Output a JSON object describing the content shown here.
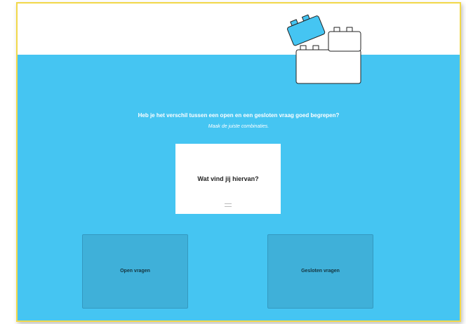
{
  "exercise": {
    "question": "Heb je het verschil tussen een open en een gesloten vraag goed begrepen?",
    "instruction": "Maak de juiste combinaties."
  },
  "card": {
    "text": "Wat vind jij hiervan?"
  },
  "targets": [
    {
      "label": "Open vragen"
    },
    {
      "label": "Gesloten vragen"
    }
  ],
  "colors": {
    "background_blue": "#45c5f2",
    "drop_zone": "#3fb0d9",
    "brick_blue": "#45c5f2",
    "frame_border": "#f2d84a"
  },
  "icons": [
    "toy-bricks-icon",
    "drag-handle-icon"
  ]
}
